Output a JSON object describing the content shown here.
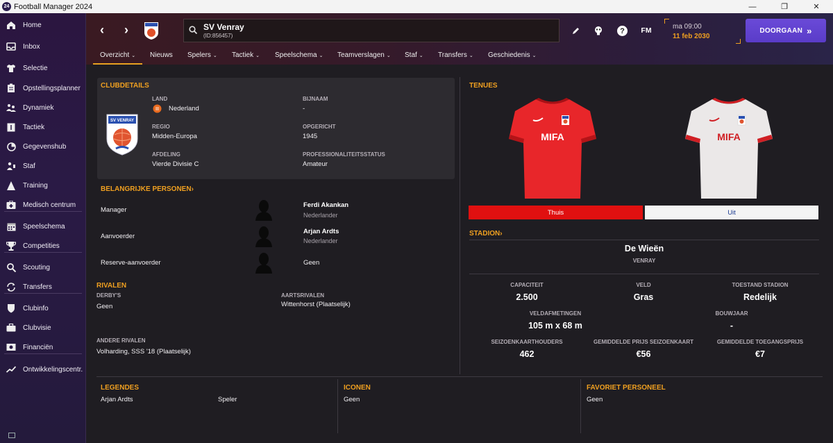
{
  "window": {
    "app_logo": "24",
    "title": "Football Manager 2024",
    "minimize": "—",
    "maximize": "❐",
    "close": "✕"
  },
  "sidebar": {
    "items": [
      {
        "label": "Home",
        "icon": "home-icon"
      },
      {
        "label": "Inbox",
        "icon": "inbox-icon"
      },
      {
        "label": "Selectie",
        "icon": "shirt-icon"
      },
      {
        "label": "Opstellingsplanner",
        "icon": "clipboard-icon"
      },
      {
        "label": "Dynamiek",
        "icon": "people-icon"
      },
      {
        "label": "Tactiek",
        "icon": "tactics-icon"
      },
      {
        "label": "Gegevenshub",
        "icon": "data-icon"
      },
      {
        "label": "Staf",
        "icon": "staff-icon"
      },
      {
        "label": "Training",
        "icon": "training-icon"
      },
      {
        "label": "Medisch centrum",
        "icon": "medical-icon"
      },
      {
        "label": "Speelschema",
        "icon": "calendar-icon"
      },
      {
        "label": "Competities",
        "icon": "trophy-icon"
      },
      {
        "label": "Scouting",
        "icon": "scouting-icon"
      },
      {
        "label": "Transfers",
        "icon": "transfers-icon"
      },
      {
        "label": "Clubinfo",
        "icon": "shield-icon"
      },
      {
        "label": "Clubvisie",
        "icon": "briefcase-icon"
      },
      {
        "label": "Financiën",
        "icon": "finances-icon"
      },
      {
        "label": "Ontwikkelingscentr.",
        "icon": "development-icon"
      }
    ]
  },
  "header": {
    "club_name": "SV Venray",
    "club_id": "(ID:856457)",
    "fm_label": "FM",
    "time": "ma 09:00",
    "date": "11 feb 2030",
    "continue_label": "DOORGAAN",
    "continue_icon": "»",
    "tabs": [
      {
        "label": "Overzicht",
        "chevron": true
      },
      {
        "label": "Nieuws",
        "chevron": false
      },
      {
        "label": "Spelers",
        "chevron": true
      },
      {
        "label": "Tactiek",
        "chevron": true
      },
      {
        "label": "Speelschema",
        "chevron": true
      },
      {
        "label": "Teamverslagen",
        "chevron": true
      },
      {
        "label": "Staf",
        "chevron": true
      },
      {
        "label": "Transfers",
        "chevron": true
      },
      {
        "label": "Geschiedenis",
        "chevron": true
      }
    ]
  },
  "clubdetails": {
    "title": "CLUBDETAILS",
    "crest_text": "SV VENRAY",
    "land_label": "LAND",
    "land_value": "Nederland",
    "bijnaam_label": "BIJNAAM",
    "bijnaam_value": "-",
    "regio_label": "REGIO",
    "regio_value": "Midden-Europa",
    "opgericht_label": "OPGERICHT",
    "opgericht_value": "1945",
    "afdeling_label": "AFDELING",
    "afdeling_value": "Vierde Divisie C",
    "prof_label": "PROFESSIONALITEITSSTATUS",
    "prof_value": "Amateur"
  },
  "key_people": {
    "title": "BELANGRIJKE PERSONEN",
    "rows": [
      {
        "role": "Manager",
        "name": "Ferdi Akankan",
        "nationality": "Nederlander"
      },
      {
        "role": "Aanvoerder",
        "name": "Arjan Ardts",
        "nationality": "Nederlander"
      },
      {
        "role": "Reserve-aanvoerder",
        "name": "Geen",
        "nationality": ""
      }
    ]
  },
  "rivals": {
    "title": "RIVALEN",
    "derbys_label": "DERBY'S",
    "derbys_value": "Geen",
    "aartsrivalen_label": "AARTSRIVALEN",
    "aartsrivalen_value": "Wittenhorst (Plaatselijk)",
    "andere_label": "ANDERE RIVALEN",
    "andere_value": "Volharding, SSS '18 (Plaatselijk)"
  },
  "kits": {
    "title": "TENUES",
    "sponsor": "MIFA",
    "home_label": "Thuis",
    "away_label": "Uit",
    "home_color": "#e01010",
    "away_color": "#f4f4f4"
  },
  "stadium": {
    "title": "STADION",
    "name": "De Wieën",
    "city": "VENRAY",
    "capaciteit_label": "CAPACITEIT",
    "capaciteit_value": "2.500",
    "veld_label": "VELD",
    "veld_value": "Gras",
    "toestand_label": "TOESTAND STADION",
    "toestand_value": "Redelijk",
    "afmetingen_label": "VELDAFMETINGEN",
    "afmetingen_value": "105 m x 68 m",
    "bouwjaar_label": "BOUWJAAR",
    "bouwjaar_value": "-",
    "houders_label": "SEIZOENKAARTHOUDERS",
    "houders_value": "462",
    "prijs_label": "GEMIDDELDE PRIJS SEIZOENKAART",
    "prijs_value": "€56",
    "toegang_label": "GEMIDDELDE TOEGANGSPRIJS",
    "toegang_value": "€7"
  },
  "bottom": {
    "legendes_title": "LEGENDES",
    "legende_name": "Arjan Ardts",
    "legende_role": "Speler",
    "iconen_title": "ICONEN",
    "iconen_value": "Geen",
    "favoriet_title": "FAVORIET PERSONEEL",
    "favoriet_value": "Geen"
  },
  "colors": {
    "accent": "#f0a020",
    "continue": "#5a3cc8"
  }
}
